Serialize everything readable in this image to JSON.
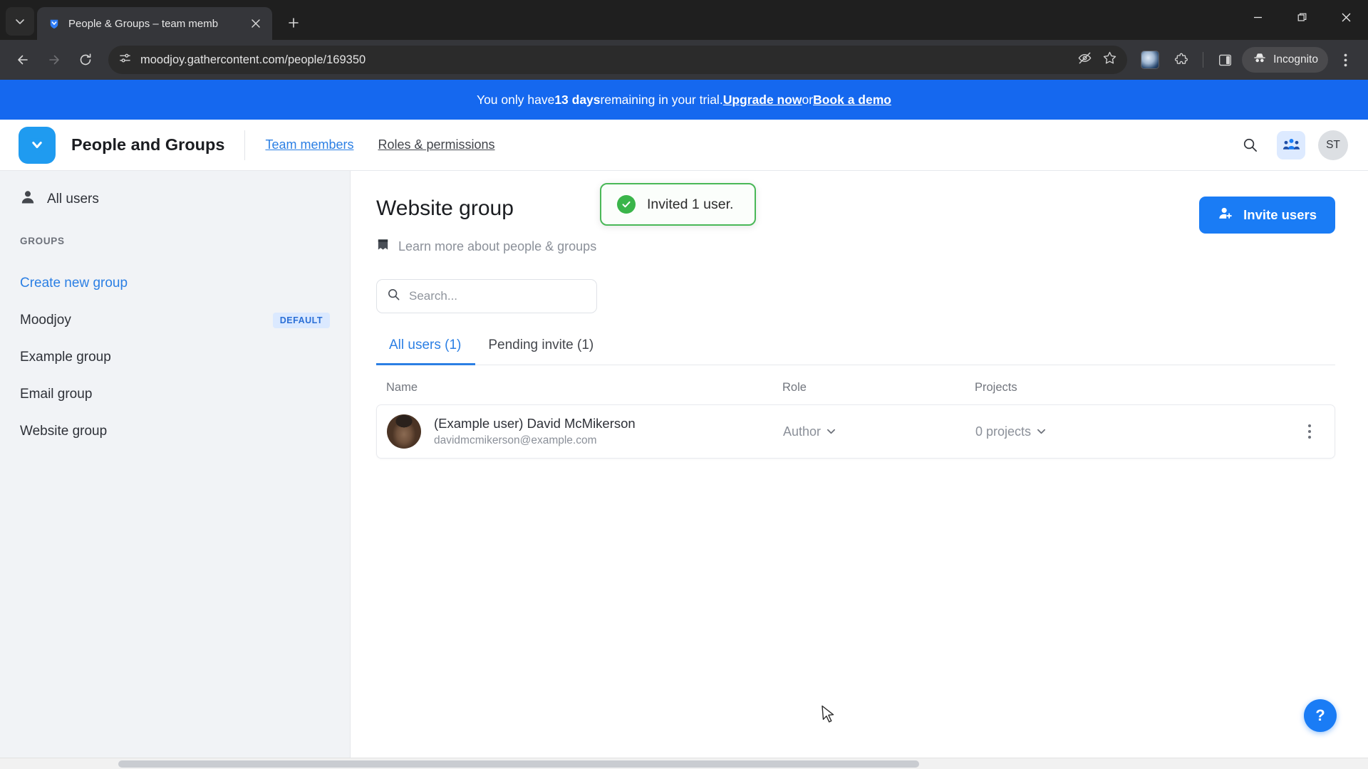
{
  "browser": {
    "tab": {
      "title": "People & Groups – team memb",
      "favicon_icon": "gathercontent-logo-icon",
      "close_icon": "close-icon",
      "tab_list_icon": "chevron-down-icon",
      "new_tab_icon": "plus-icon"
    },
    "window_controls": {
      "minimize_icon": "minimize-icon",
      "maximize_icon": "maximize-icon",
      "close_icon": "window-close-icon"
    },
    "toolbar": {
      "back_icon": "back-arrow-icon",
      "forward_icon": "forward-arrow-icon",
      "reload_icon": "reload-icon",
      "site_info_icon": "site-settings-icon",
      "url": "moodjoy.gathercontent.com/people/169350",
      "tracking_protection_icon": "eye-slash-icon",
      "bookmark_icon": "star-icon",
      "profile_icon": "profile-avatar-icon",
      "extensions_icon": "extensions-puzzle-icon",
      "side_panel_icon": "side-panel-icon",
      "incognito_label": "Incognito",
      "incognito_icon": "incognito-hat-icon",
      "menu_icon": "three-dot-menu-icon"
    }
  },
  "banner": {
    "text_before": "You only have ",
    "days": "13 days",
    "text_after": " remaining in your trial. ",
    "upgrade_label": "Upgrade now",
    "or_label": " or ",
    "demo_label": "Book a demo",
    "background_color": "#1568ef"
  },
  "toast": {
    "message": "Invited 1 user.",
    "icon": "success-check-icon",
    "border_color": "#4ab858",
    "icon_color": "#3ab54a"
  },
  "header": {
    "logo_icon": "gathercontent-logo-icon",
    "brand": "People and Groups",
    "nav": [
      {
        "label": "Team members",
        "active": true
      },
      {
        "label": "Roles & permissions",
        "active": false
      }
    ],
    "search_icon": "search-icon",
    "people_icon": "people-group-icon",
    "avatar_initials": "ST"
  },
  "sidebar": {
    "all_users": {
      "label": "All users",
      "icon": "person-icon"
    },
    "groups_heading": "GROUPS",
    "items": [
      {
        "label": "Create new group",
        "is_link": true,
        "badge": ""
      },
      {
        "label": "Moodjoy",
        "is_link": false,
        "badge": "DEFAULT"
      },
      {
        "label": "Example group",
        "is_link": false,
        "badge": ""
      },
      {
        "label": "Email group",
        "is_link": false,
        "badge": ""
      },
      {
        "label": "Website group",
        "is_link": false,
        "badge": ""
      }
    ]
  },
  "main": {
    "title": "Website group",
    "learn_more": {
      "label": "Learn more about people & groups",
      "icon": "book-icon"
    },
    "invite_button": {
      "label": "Invite users",
      "icon": "add-person-icon",
      "color": "#1a7cf5"
    },
    "search": {
      "placeholder": "Search...",
      "value": "",
      "icon": "search-icon"
    },
    "tabs": [
      {
        "label": "All users (1)",
        "active": true
      },
      {
        "label": "Pending invite (1)",
        "active": false
      }
    ],
    "table": {
      "columns": [
        "Name",
        "Role",
        "Projects"
      ],
      "rows": [
        {
          "avatar_icon": "user-photo-avatar",
          "name": "(Example user) David McMikerson",
          "email": "davidmcmikerson@example.com",
          "role": "Author",
          "role_chevron_icon": "chevron-down-icon",
          "projects": "0 projects",
          "projects_chevron_icon": "chevron-down-icon",
          "menu_icon": "kebab-menu-icon"
        }
      ]
    },
    "help_button": {
      "label": "?",
      "icon": "help-icon"
    }
  }
}
